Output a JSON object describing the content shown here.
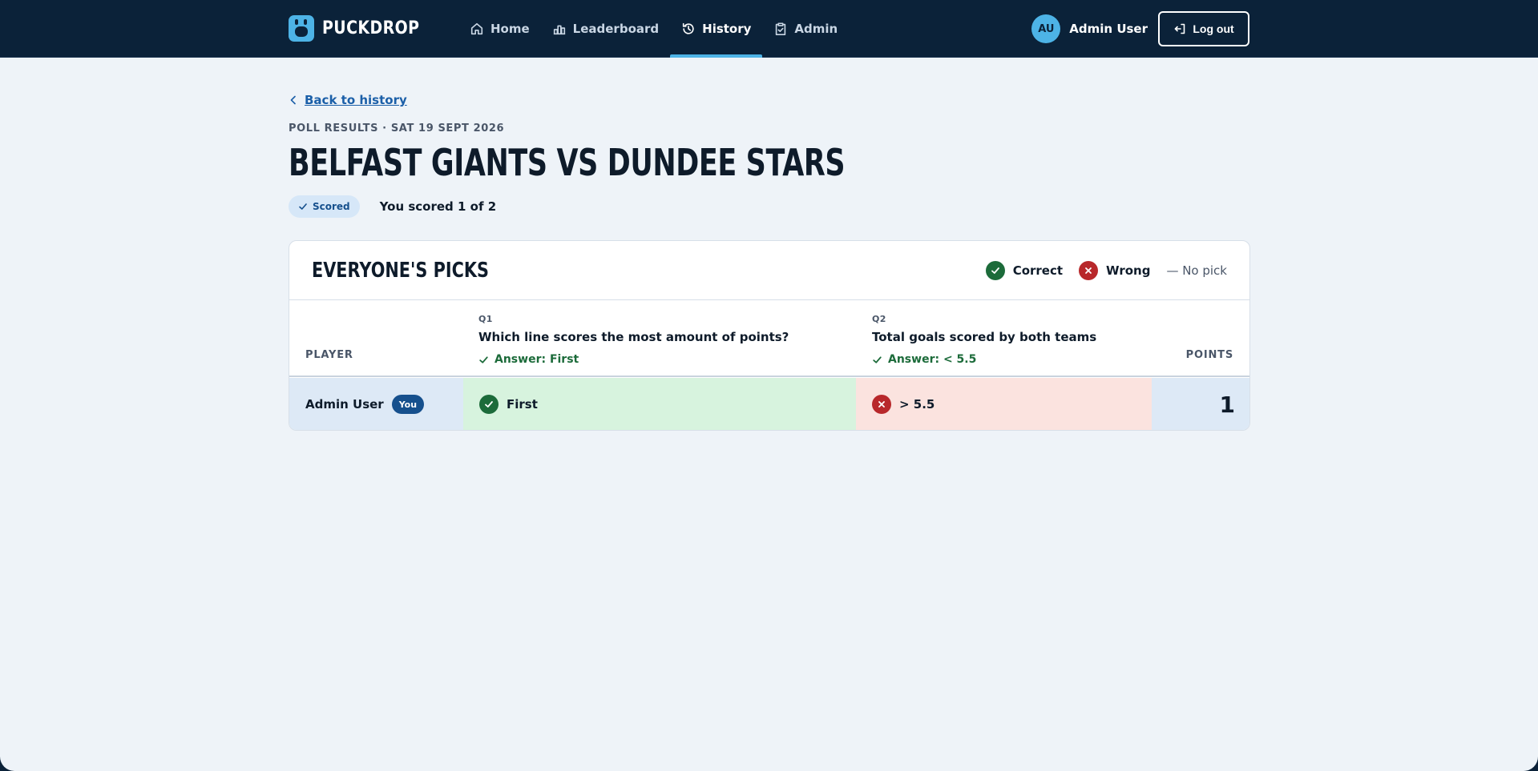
{
  "brand": {
    "name": "PUCKDROP"
  },
  "nav": {
    "links": [
      {
        "label": "Home",
        "icon": "home-icon"
      },
      {
        "label": "Leaderboard",
        "icon": "leaderboard-icon"
      },
      {
        "label": "History",
        "icon": "history-icon",
        "active": true
      },
      {
        "label": "Admin",
        "icon": "clipboard-check-icon"
      }
    ],
    "user": {
      "initials": "AU",
      "name": "Admin User"
    },
    "logout_label": "Log out"
  },
  "page": {
    "back_label": "Back to history",
    "kicker": "POLL RESULTS · SAT 19 SEPT 2026",
    "title": "BELFAST GIANTS VS DUNDEE STARS",
    "status_badge": "Scored",
    "score_summary": "You scored 1 of 2"
  },
  "picks": {
    "title": "EVERYONE'S PICKS",
    "legend": {
      "correct": "Correct",
      "wrong": "Wrong",
      "no_pick": "— No pick"
    },
    "columns": {
      "player": "PLAYER",
      "points": "POINTS",
      "questions": [
        {
          "number": "Q1",
          "text": "Which line scores the most amount of points?",
          "answer": "Answer: First"
        },
        {
          "number": "Q2",
          "text": "Total goals scored by both teams",
          "answer": "Answer: < 5.5"
        }
      ]
    },
    "rows": [
      {
        "player": "Admin User",
        "you_badge": "You",
        "picks": [
          {
            "value": "First",
            "result": "correct"
          },
          {
            "value": "> 5.5",
            "result": "wrong"
          }
        ],
        "points": "1"
      }
    ]
  },
  "colors": {
    "nav_bg": "#0b2239",
    "accent": "#4db3e6",
    "link": "#1b5fa8",
    "correct": "#1c6b3a",
    "wrong": "#b8282b",
    "correct_bg": "#d7f3de",
    "wrong_bg": "#fbe3df",
    "highlight_bg": "#dde9f6"
  }
}
